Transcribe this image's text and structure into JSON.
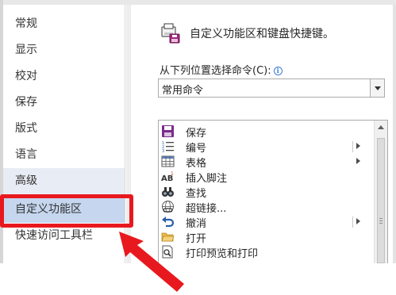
{
  "nav": {
    "items": [
      {
        "label": "常规"
      },
      {
        "label": "显示"
      },
      {
        "label": "校对"
      },
      {
        "label": "保存"
      },
      {
        "label": "版式"
      },
      {
        "label": "语言"
      },
      {
        "label": "高级"
      },
      {
        "label": "自定义功能区"
      },
      {
        "label": "快速访问工具栏"
      }
    ],
    "selected": "自定义功能区"
  },
  "main": {
    "header_title": "自定义功能区和键盘快捷键。",
    "choose_label": "从下列位置选择命令(C):",
    "info_icon": "info-icon",
    "select_value": "常用命令",
    "commands": [
      {
        "label": "保存",
        "icon": "save-icon",
        "submenu": false
      },
      {
        "label": "编号",
        "icon": "numbering-icon",
        "submenu": true
      },
      {
        "label": "表格",
        "icon": "table-icon",
        "submenu": true
      },
      {
        "label": "插入脚注",
        "icon": "footnote-icon",
        "submenu": false
      },
      {
        "label": "查找",
        "icon": "find-icon",
        "submenu": false
      },
      {
        "label": "超链接...",
        "icon": "hyperlink-icon",
        "submenu": false
      },
      {
        "label": "撤消",
        "icon": "undo-icon",
        "submenu": true
      },
      {
        "label": "打开",
        "icon": "open-folder-icon",
        "submenu": false
      },
      {
        "label": "打印预览和打印",
        "icon": "print-preview-icon",
        "submenu": false
      }
    ]
  },
  "colors": {
    "highlight": "#e8191e",
    "selected_bg": "#c5d6ee",
    "accent": "#3b7ad9"
  }
}
